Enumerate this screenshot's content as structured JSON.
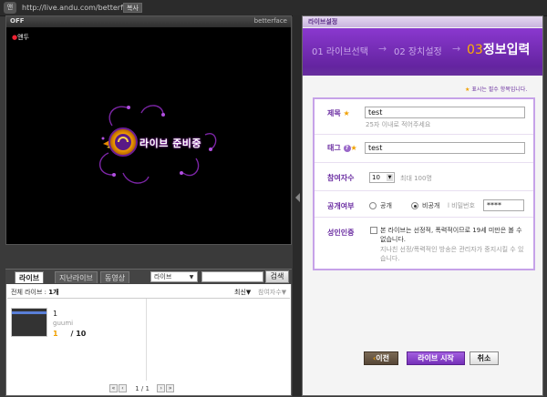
{
  "topbar": {
    "logo_badge": "앤",
    "url": "http://live.andu.com/betterface",
    "copy_label": "복사"
  },
  "player": {
    "status_label": "OFF",
    "channel_name": "betterface",
    "mini_logo": "앤두",
    "ready_text": "라이브 준비중"
  },
  "list": {
    "tabs": [
      "라이브",
      "지난라이브",
      "동영상"
    ],
    "filter_select": "라이브",
    "search_button": "검색",
    "total_label": "전체 라이브 :",
    "total_count": "1개",
    "sort_latest": "최신▼",
    "sort_viewers": "참여자수▼",
    "items": [
      {
        "title": "1",
        "user": "guumi",
        "current": "1",
        "max": "/ 10"
      }
    ],
    "pager_text": "1 / 1",
    "pager_first": "«",
    "pager_prev": "‹",
    "pager_next": "›",
    "pager_last": "»"
  },
  "settings": {
    "header": "라이브설정",
    "steps": [
      {
        "num": "01",
        "label": "라이브선택"
      },
      {
        "num": "02",
        "label": "장치설정"
      },
      {
        "num": "03",
        "label": "정보입력"
      }
    ],
    "required_note": "표시는 필수 항목입니다.",
    "required_star": "★",
    "title_label": "제목",
    "title_value": "test",
    "title_hint": "25자 이내로 적어주세요",
    "tag_label": "태그",
    "tag_help": "?",
    "tag_value": "test",
    "participants_label": "참여자수",
    "participants_value": "10",
    "participants_hint": "최대 100명",
    "visibility_label": "공개여부",
    "visibility_public": "공개",
    "visibility_private": "비공개",
    "password_label": "l 비밀번호",
    "password_value": "****",
    "adult_label": "성인인증",
    "adult_notice": "본 라이브는 선정적, 폭력적이므로 19세 미만은 볼 수 없습니다.",
    "adult_notice2": "지나친 선정/폭력적인 방송은 관리자가 중지시킬 수 있습니다."
  },
  "buttons": {
    "prev": "이전",
    "start": "라이브 시작",
    "cancel": "취소"
  },
  "colors": {
    "brand_purple": "#7530b8",
    "accent_orange": "#f0a000"
  }
}
